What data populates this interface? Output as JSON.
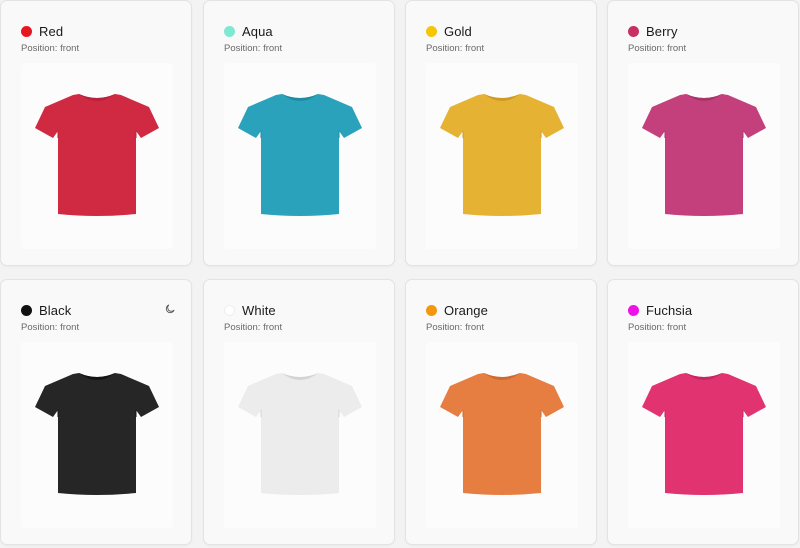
{
  "position_label": "Position: front",
  "cards": [
    {
      "name": "Red",
      "dot": "#e4181f",
      "shirt": "#d02a43",
      "shirt_shade": "#b8213a"
    },
    {
      "name": "Aqua",
      "dot": "#7fe9cf",
      "shirt": "#2aa2bb",
      "shirt_shade": "#1f8ba3"
    },
    {
      "name": "Gold",
      "dot": "#f3c800",
      "shirt": "#e6b234",
      "shirt_shade": "#cd9b25"
    },
    {
      "name": "Berry",
      "dot": "#c73063",
      "shirt": "#c4407c",
      "shirt_shade": "#a83368"
    },
    {
      "name": "Black",
      "dot": "#111111",
      "shirt": "#262626",
      "shirt_shade": "#141414",
      "has_mode_icon": true,
      "mode_icon": "moon-icon"
    },
    {
      "name": "White",
      "dot": "#ffffff",
      "shirt": "#ececec",
      "shirt_shade": "#d3d3d3"
    },
    {
      "name": "Orange",
      "dot": "#f0990f",
      "shirt": "#e77e41",
      "shirt_shade": "#cd6a31"
    },
    {
      "name": "Fuchsia",
      "dot": "#ee12e8",
      "shirt": "#e0336f",
      "shirt_shade": "#c4285d"
    }
  ]
}
